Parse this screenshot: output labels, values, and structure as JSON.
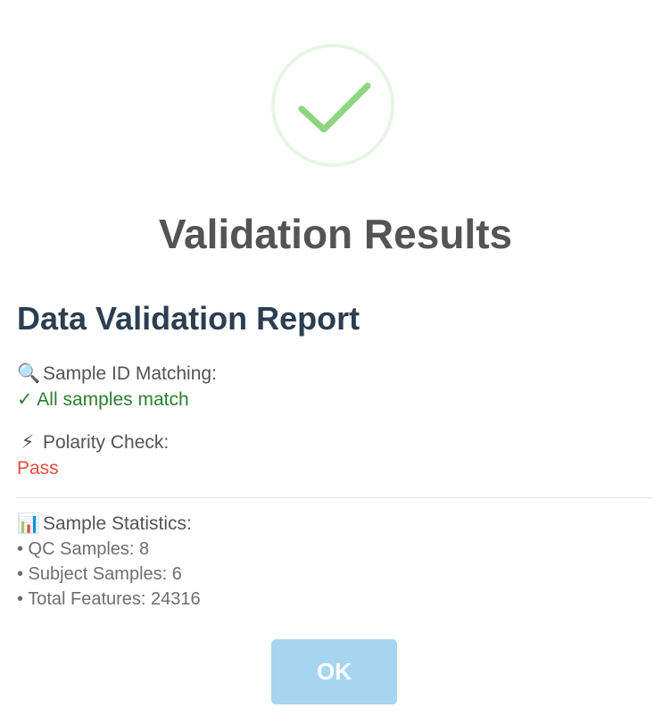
{
  "dialog": {
    "icon": "success-checkmark-icon",
    "icon_ring_color": "#e8f5e4",
    "icon_check_color": "#8fd480",
    "title": "Validation Results"
  },
  "report": {
    "title": "Data Validation Report",
    "sample_id": {
      "icon": "magnifier-icon",
      "emoji": "🔍",
      "label": "Sample ID Matching:",
      "status": "✓ All samples match",
      "status_color": "#2e7d32"
    },
    "polarity": {
      "icon": "lightning-icon",
      "emoji": "⚡",
      "label": "Polarity Check:",
      "status": "Pass",
      "status_color": "#e74c3c"
    },
    "statistics": {
      "icon": "bar-chart-icon",
      "emoji": "📊",
      "label": "Sample Statistics:",
      "lines": [
        "• QC Samples: 8",
        "• Subject Samples: 6",
        "• Total Features: 24316"
      ]
    }
  },
  "actions": {
    "ok_label": "OK",
    "ok_color": "#a6d5ef"
  }
}
